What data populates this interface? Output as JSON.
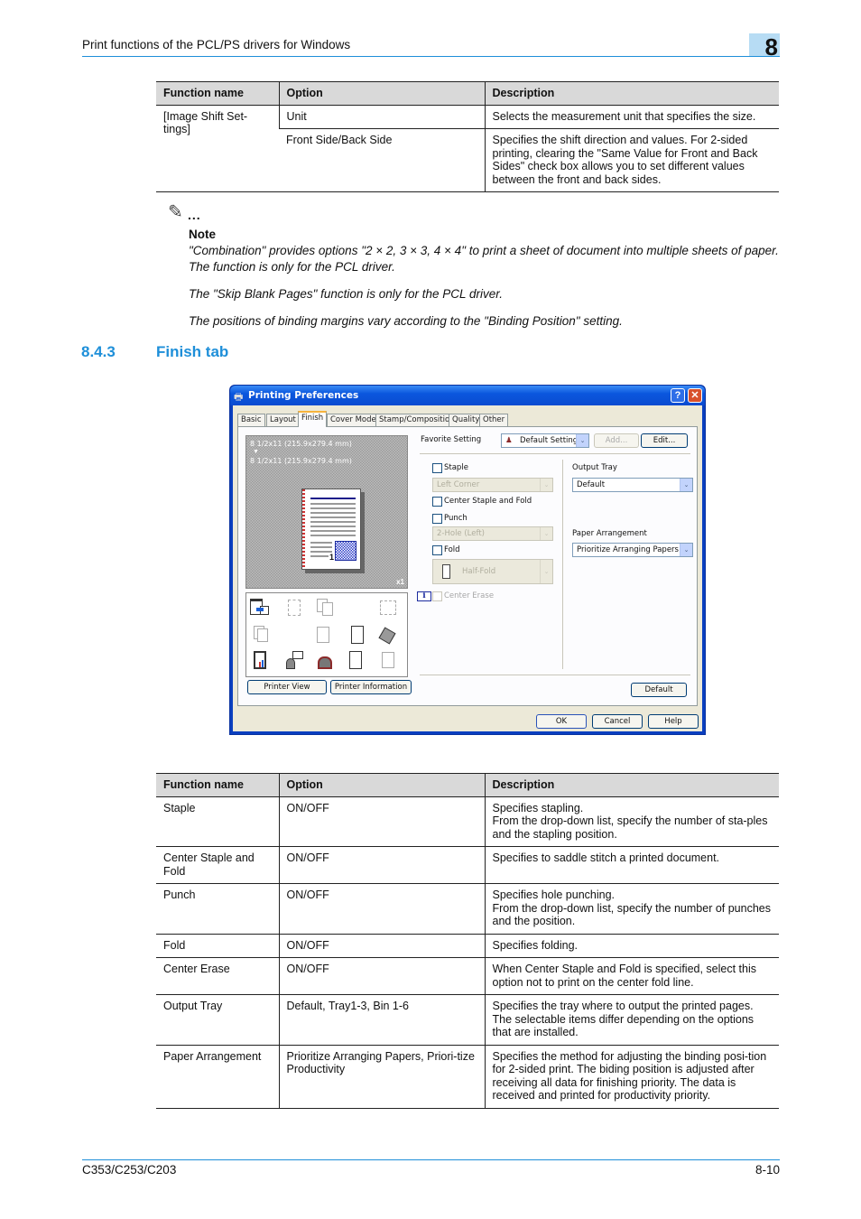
{
  "header": {
    "title": "Print functions of the PCL/PS drivers for Windows",
    "chapter": "8"
  },
  "table1": {
    "columns": [
      "Function name",
      "Option",
      "Description"
    ],
    "rows": [
      {
        "function": "[Image Shift Set-tings]",
        "option": "Unit",
        "description": "Selects the measurement unit that specifies the size."
      },
      {
        "function": "",
        "option": "Front Side/Back Side",
        "description": "Specifies the shift direction and values. For 2-sided printing, clearing the \"Same Value for Front and Back Sides\" check box allows you to set different values between the front and back sides."
      }
    ]
  },
  "note": {
    "dots": "...",
    "label": "Note",
    "paragraphs": [
      "\"Combination\" provides options \"2 × 2, 3 × 3, 4 × 4\" to print a sheet of document into multiple sheets of paper. The function is only for the PCL driver.",
      "The \"Skip Blank Pages\" function is only for the PCL driver.",
      "The positions of binding margins vary according to the \"Binding Position\" setting."
    ]
  },
  "section": {
    "number": "8.4.3",
    "title": "Finish tab"
  },
  "dialog": {
    "title": "Printing Preferences",
    "help_glyph": "?",
    "close_glyph": "✕",
    "tabs": [
      "Basic",
      "Layout",
      "Finish",
      "Cover Mode",
      "Stamp/Composition",
      "Quality",
      "Other"
    ],
    "active_tab": "Finish",
    "preview": {
      "paper_from": "8 1/2x11 (215.9x279.4 mm)",
      "arrow": "▼",
      "paper_to": "8 1/2x11 (215.9x279.4 mm)",
      "page_number": "1",
      "copies": "x1"
    },
    "buttons": {
      "printer_view": "Printer View",
      "printer_information": "Printer Information",
      "add": "Add...",
      "edit": "Edit...",
      "default": "Default",
      "ok": "OK",
      "cancel": "Cancel",
      "help": "Help"
    },
    "favorite_setting": {
      "label": "Favorite Setting",
      "value": "Default Setting"
    },
    "staple": {
      "label": "Staple",
      "checked": false,
      "value": "Left Corner"
    },
    "center_staple_fold": {
      "label": "Center Staple and Fold",
      "checked": false
    },
    "punch": {
      "label": "Punch",
      "checked": false,
      "value": "2-Hole (Left)"
    },
    "fold": {
      "label": "Fold",
      "checked": false,
      "value": "Half-Fold"
    },
    "center_erase": {
      "label": "Center Erase",
      "checked": false,
      "info_glyph": "i"
    },
    "output_tray": {
      "label": "Output Tray",
      "value": "Default"
    },
    "paper_arrangement": {
      "label": "Paper Arrangement",
      "value": "Prioritize Arranging Papers"
    },
    "dropdown_glyph": "⌄"
  },
  "table2": {
    "columns": [
      "Function name",
      "Option",
      "Description"
    ],
    "rows": [
      {
        "function": "Staple",
        "option": "ON/OFF",
        "description": [
          "Specifies stapling.",
          "From the drop-down list, specify the number of sta-ples and the stapling position."
        ]
      },
      {
        "function": "Center Staple and Fold",
        "option": "ON/OFF",
        "description": [
          "Specifies to saddle stitch a printed document."
        ]
      },
      {
        "function": "Punch",
        "option": "ON/OFF",
        "description": [
          "Specifies hole punching.",
          "From the drop-down list, specify the number of punches and the position."
        ]
      },
      {
        "function": "Fold",
        "option": "ON/OFF",
        "description": [
          "Specifies folding."
        ]
      },
      {
        "function": "Center Erase",
        "option": "ON/OFF",
        "description": [
          "When Center Staple and Fold is specified, select this option not to print on the center fold line."
        ]
      },
      {
        "function": "Output Tray",
        "option": "Default, Tray1-3, Bin 1-6",
        "description": [
          "Specifies the tray where to output the printed pages. The selectable items differ depending on the options that are installed."
        ]
      },
      {
        "function": "Paper Arrangement",
        "option": "Prioritize Arranging Papers, Priori-tize Productivity",
        "description": [
          "Specifies the method for adjusting the binding posi-tion for 2-sided print. The biding position is adjusted after receiving all data for finishing priority. The data is received and printed for productivity priority."
        ]
      }
    ]
  },
  "footer": {
    "model": "C353/C253/C203",
    "page": "8-10"
  }
}
